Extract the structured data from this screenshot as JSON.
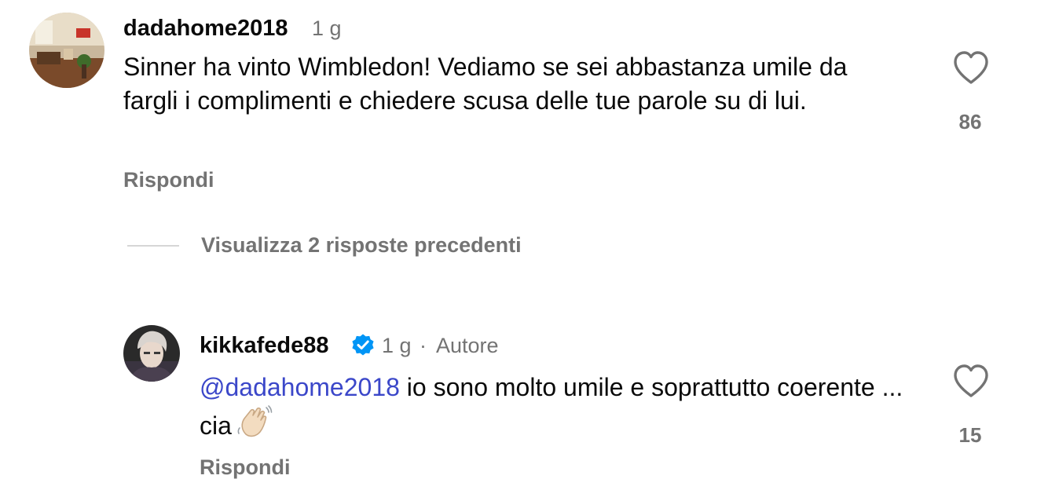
{
  "comment": {
    "username": "dadahome2018",
    "time": "1 g",
    "text": "Sinner ha vinto Wimbledon! Vediamo se sei abbastanza umile da fargli i complimenti e chiedere scusa delle tue parole su di lui.",
    "reply_label": "Rispondi",
    "likes": "86",
    "avatar_icon": "living-room-photo"
  },
  "view_replies_label": "Visualizza 2 risposte precedenti",
  "reply": {
    "username": "kikkafede88",
    "verified": true,
    "time": "1 g",
    "separator": "·",
    "author_badge": "Autore",
    "mention": "@dadahome2018",
    "text": "io sono molto umile e soprattutto coerente ... cia",
    "emoji": "waving-hand",
    "reply_label": "Rispondi",
    "likes": "15",
    "avatar_icon": "profile-photo"
  },
  "colors": {
    "text": "#0a0a0a",
    "muted": "#737373",
    "mention": "#3b47c9",
    "verified": "#0095f6"
  }
}
